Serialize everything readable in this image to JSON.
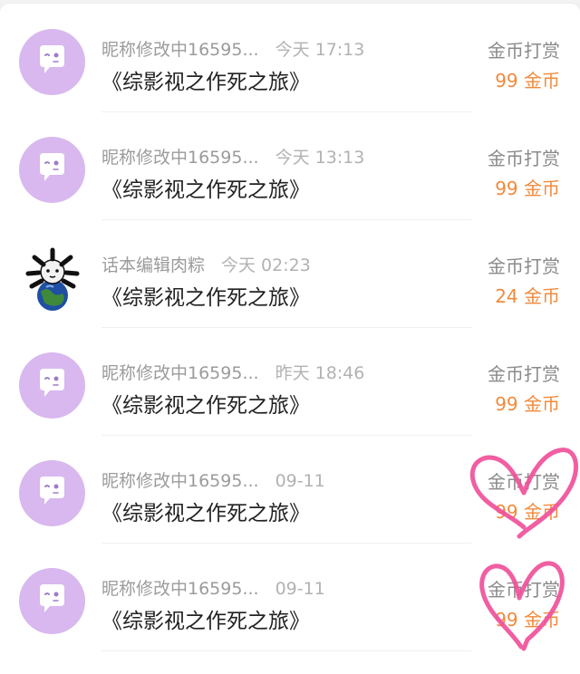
{
  "rows": [
    {
      "nickname": "昵称修改中16595...",
      "time": "今天 17:13",
      "book": "《综影视之作死之旅》",
      "label": "金币打赏",
      "amount": "99 金币",
      "avatar": "default-avatar"
    },
    {
      "nickname": "昵称修改中16595...",
      "time": "今天 13:13",
      "book": "《综影视之作死之旅》",
      "label": "金币打赏",
      "amount": "99 金币",
      "avatar": "default-avatar"
    },
    {
      "nickname": "话本编辑肉粽",
      "time": "今天 02:23",
      "book": "《综影视之作死之旅》",
      "label": "金币打赏",
      "amount": "24 金币",
      "avatar": "globe-avatar"
    },
    {
      "nickname": "昵称修改中16595...",
      "time": "昨天 18:46",
      "book": "《综影视之作死之旅》",
      "label": "金币打赏",
      "amount": "99 金币",
      "avatar": "default-avatar"
    },
    {
      "nickname": "昵称修改中16595...",
      "time": "09-11",
      "book": "《综影视之作死之旅》",
      "label": "金币打赏",
      "amount": "99 金币",
      "avatar": "default-avatar"
    },
    {
      "nickname": "昵称修改中16595...",
      "time": "09-11",
      "book": "《综影视之作死之旅》",
      "label": "金币打赏",
      "amount": "99 金币",
      "avatar": "default-avatar"
    }
  ],
  "colors": {
    "accent_orange": "#f08a3c",
    "avatar_purple": "#d8b8ef",
    "heart_pink": "#f0509a"
  }
}
